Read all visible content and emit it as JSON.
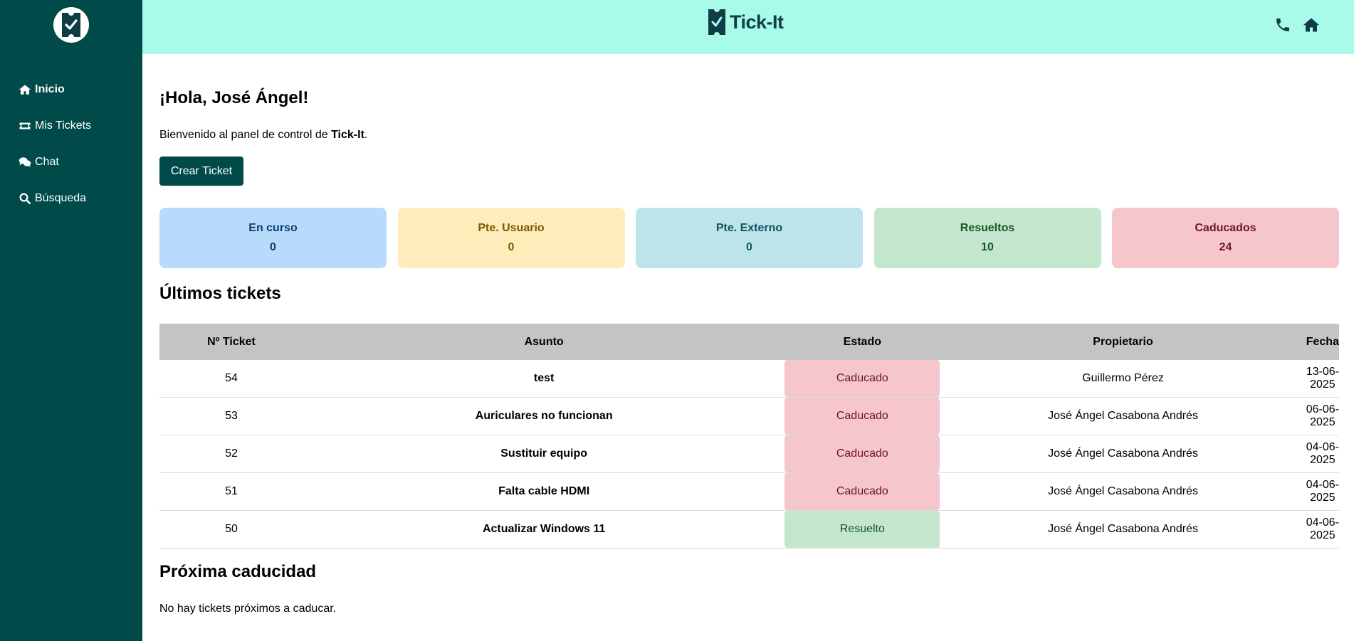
{
  "app": {
    "brand": "Tick-It"
  },
  "sidebar": {
    "items": [
      {
        "label": "Inicio",
        "icon": "home-icon"
      },
      {
        "label": "Mis Tickets",
        "icon": "ticket-icon"
      },
      {
        "label": "Chat",
        "icon": "chat-icon"
      },
      {
        "label": "Búsqueda",
        "icon": "search-icon"
      }
    ]
  },
  "header": {
    "phone_icon": "phone-icon",
    "home_icon": "home-icon"
  },
  "main": {
    "greeting": "¡Hola, José Ángel!",
    "welcome_prefix": "Bienvenido al panel de control de ",
    "welcome_brand": "Tick-It",
    "welcome_suffix": ".",
    "create_button": "Crear Ticket"
  },
  "stats": [
    {
      "label": "En curso",
      "value": "0",
      "bg": "#b8dbfc",
      "color": "#0b3d6e"
    },
    {
      "label": "Pte. Usuario",
      "value": "0",
      "bg": "#feedbb",
      "color": "#7a5a00"
    },
    {
      "label": "Pte. Externo",
      "value": "0",
      "bg": "#bde4ea",
      "color": "#0b5460"
    },
    {
      "label": "Resueltos",
      "value": "10",
      "bg": "#c4e6cc",
      "color": "#125a24"
    },
    {
      "label": "Caducados",
      "value": "24",
      "bg": "#f5c6cc",
      "color": "#6e1620"
    }
  ],
  "latest": {
    "title": "Últimos tickets",
    "columns": [
      "Nº Ticket",
      "Asunto",
      "Estado",
      "Propietario",
      "Fecha"
    ],
    "rows": [
      {
        "id": "54",
        "subject": "test",
        "state": "Caducado",
        "state_type": "expired",
        "owner": "Guillermo Pérez",
        "date": "13-06-2025"
      },
      {
        "id": "53",
        "subject": "Auriculares no funcionan",
        "state": "Caducado",
        "state_type": "expired",
        "owner": "José Ángel Casabona Andrés",
        "date": "06-06-2025"
      },
      {
        "id": "52",
        "subject": "Sustituir equipo",
        "state": "Caducado",
        "state_type": "expired",
        "owner": "José Ángel Casabona Andrés",
        "date": "04-06-2025"
      },
      {
        "id": "51",
        "subject": "Falta cable HDMI",
        "state": "Caducado",
        "state_type": "expired",
        "owner": "José Ángel Casabona Andrés",
        "date": "04-06-2025"
      },
      {
        "id": "50",
        "subject": "Actualizar Windows 11",
        "state": "Resuelto",
        "state_type": "resolved",
        "owner": "José Ángel Casabona Andrés",
        "date": "04-06-2025"
      }
    ]
  },
  "state_colors": {
    "expired": {
      "bg": "#f5c6cc",
      "color": "#6e1620"
    },
    "resolved": {
      "bg": "#c4e6cc",
      "color": "#125a24"
    }
  },
  "upcoming": {
    "title": "Próxima caducidad",
    "empty_text": "No hay tickets próximos a caducar."
  }
}
